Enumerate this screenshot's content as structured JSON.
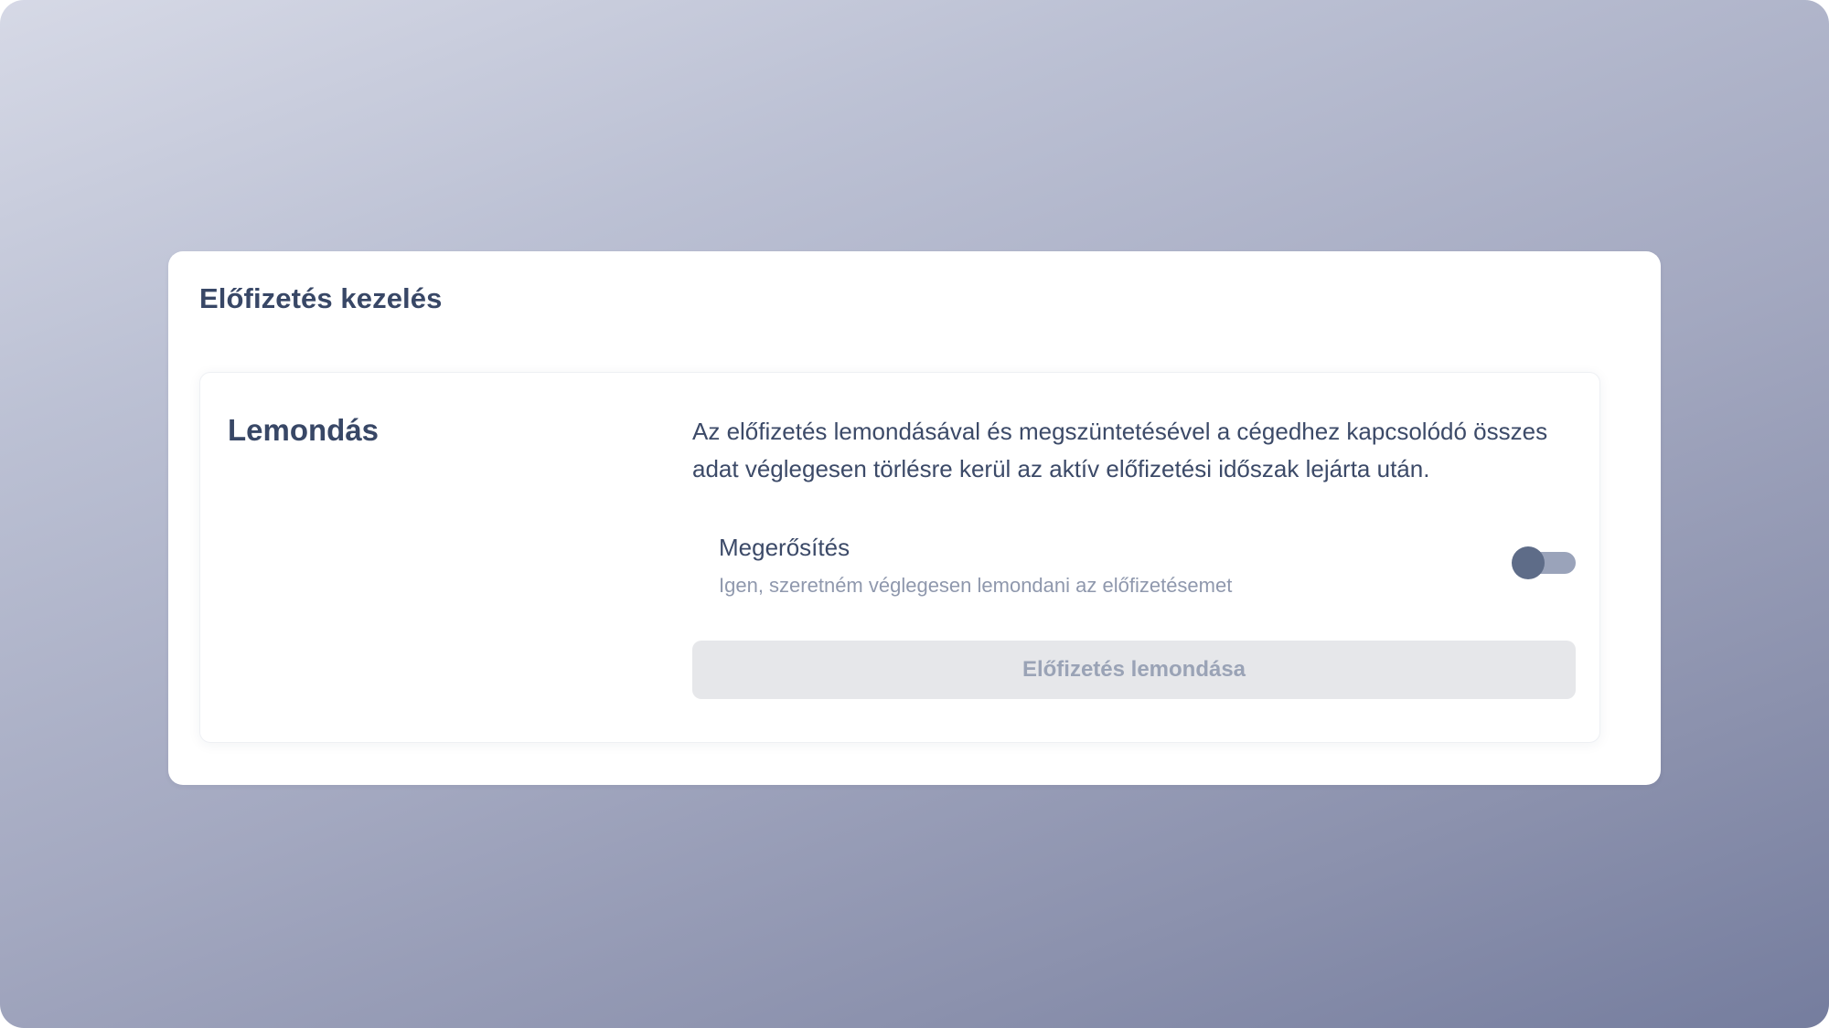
{
  "panel": {
    "title": "Előfizetés kezelés"
  },
  "cancellation": {
    "heading": "Lemondás",
    "description": "Az előfizetés lemondásával és megszüntetésével a cégedhez kapcsolódó összes adat véglegesen törlésre kerül az aktív előfizetési időszak lejárta után.",
    "confirm": {
      "label": "Megerősítés",
      "help": "Igen, szeretném véglegesen lemondani az előfizetésemet",
      "toggle_on": false
    },
    "button_label": "Előfizetés lemondása",
    "button_disabled": true
  },
  "colors": {
    "text_primary": "#384766",
    "text_muted": "#8f98ad",
    "toggle_knob": "#5e6c88",
    "toggle_track": "#9aa3ba",
    "button_disabled_bg": "#e6e7ea"
  }
}
